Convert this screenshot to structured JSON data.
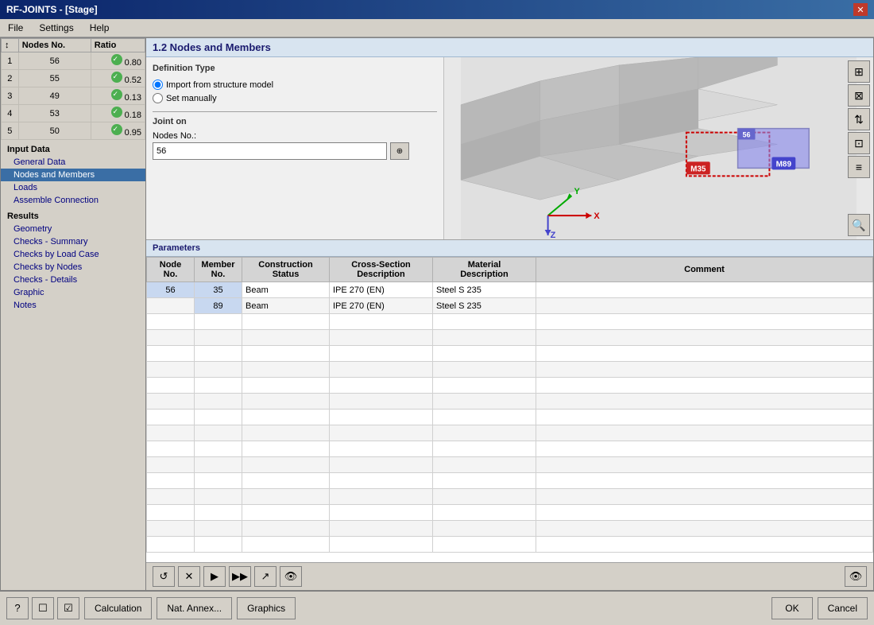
{
  "window": {
    "title": "RF-JOINTS - [Stage]",
    "close_label": "✕"
  },
  "menu": {
    "items": [
      "File",
      "Settings",
      "Help"
    ]
  },
  "left_table": {
    "headers": [
      "↕",
      "Nodes No.",
      "Ratio"
    ],
    "rows": [
      {
        "id": 1,
        "node": 56,
        "ratio": "0.80"
      },
      {
        "id": 2,
        "node": 55,
        "ratio": "0.52"
      },
      {
        "id": 3,
        "node": 49,
        "ratio": "0.13"
      },
      {
        "id": 4,
        "node": 53,
        "ratio": "0.18"
      },
      {
        "id": 5,
        "node": 50,
        "ratio": "0.95"
      }
    ]
  },
  "nav": {
    "input_data_label": "Input Data",
    "items_input": [
      {
        "label": "General Data",
        "active": false
      },
      {
        "label": "Nodes and Members",
        "active": true
      },
      {
        "label": "Loads",
        "active": false
      },
      {
        "label": "Assemble Connection",
        "active": false
      }
    ],
    "results_label": "Results",
    "items_results": [
      {
        "label": "Geometry",
        "active": false
      },
      {
        "label": "Checks - Summary",
        "active": false
      },
      {
        "label": "Checks by Load Case",
        "active": false
      },
      {
        "label": "Checks by Nodes",
        "active": false
      },
      {
        "label": "Checks - Details",
        "active": false
      },
      {
        "label": "Graphic",
        "active": false
      },
      {
        "label": "Notes",
        "active": false
      }
    ]
  },
  "panel_title": "1.2 Nodes and Members",
  "definition_type": {
    "label": "Definition Type",
    "options": [
      {
        "label": "Import from structure model",
        "selected": true
      },
      {
        "label": "Set manually",
        "selected": false
      }
    ]
  },
  "joint_on": {
    "label": "Joint on",
    "nodes_no_label": "Nodes No.:",
    "nodes_no_value": "56",
    "btn_icon": "⊕"
  },
  "parameters": {
    "label": "Parameters",
    "headers": [
      "Node No.",
      "Member No.",
      "Construction Status",
      "Cross-Section Description",
      "Material Description",
      "Comment"
    ],
    "rows": [
      {
        "node_no": "56",
        "member_no": "35",
        "construction_status": "Beam",
        "cross_section": "IPE 270 (EN)",
        "material": "Steel S 235",
        "comment": ""
      },
      {
        "node_no": "",
        "member_no": "89",
        "construction_status": "Beam",
        "cross_section": "IPE 270 (EN)",
        "material": "Steel S 235",
        "comment": ""
      }
    ]
  },
  "toolbar": {
    "btn_reset": "↺",
    "btn_delete": "✕",
    "btn_next": "▶",
    "btn_next_next": "▶▶",
    "btn_export": "↗",
    "btn_eye": "👁"
  },
  "view_toolbar": {
    "btn1": "⊞",
    "btn2": "⊠",
    "btn3": "↕",
    "btn4": "⊡",
    "btn5": "☰"
  },
  "bottom_bar": {
    "icon1": "?",
    "icon2": "☐",
    "icon3": "☑",
    "calculation_label": "Calculation",
    "nat_annex_label": "Nat. Annex...",
    "graphics_label": "Graphics",
    "ok_label": "OK",
    "cancel_label": "Cancel"
  },
  "colors": {
    "accent_blue": "#1a3a8a",
    "header_blue": "#d8e4f0",
    "node_56_color": "#4444cc",
    "member_m35_color": "#cc0000",
    "member_m89_color": "#4444cc"
  }
}
